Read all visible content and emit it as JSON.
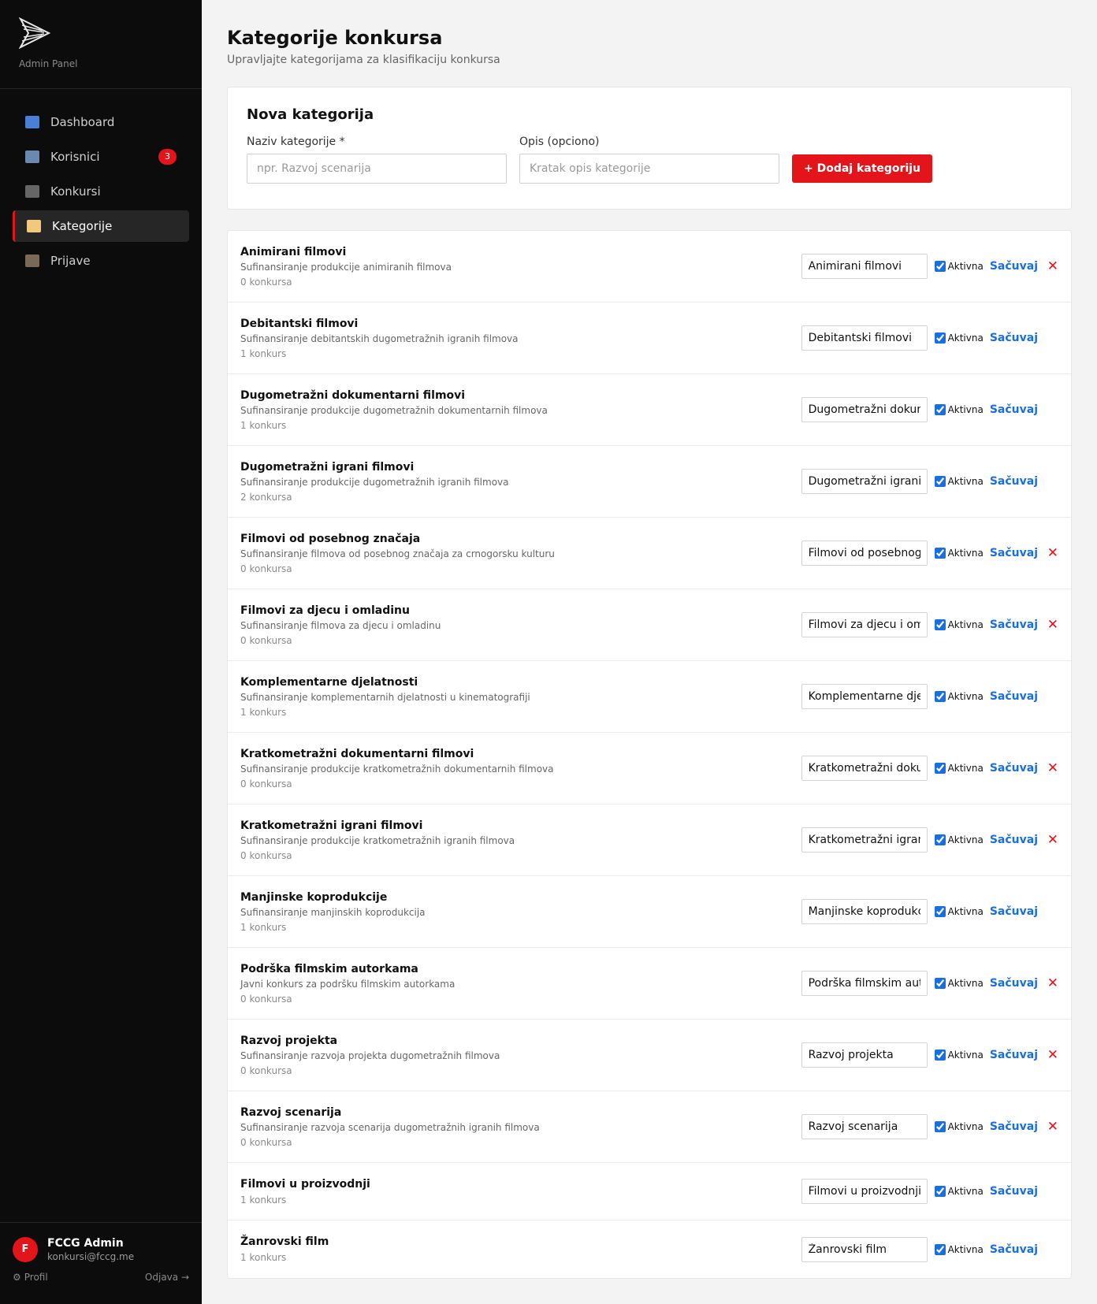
{
  "sidebar": {
    "logo_sub": "Admin Panel",
    "nav": [
      {
        "label": "Dashboard",
        "icon": "chart-icon",
        "color": "#4a7fd6"
      },
      {
        "label": "Korisnici",
        "icon": "users-icon",
        "color": "#6a89b0",
        "badge": "3"
      },
      {
        "label": "Konkursi",
        "icon": "clapper-icon",
        "color": "#666666"
      },
      {
        "label": "Kategorije",
        "icon": "tag-icon",
        "color": "#f2c97a",
        "active": true
      },
      {
        "label": "Prijave",
        "icon": "clipboard-icon",
        "color": "#7a6a55"
      }
    ],
    "user": {
      "initial": "F",
      "name": "FCCG Admin",
      "email": "konkursi@fccg.me",
      "profile_label": "Profil",
      "logout_label": "Odjava →"
    }
  },
  "header": {
    "title": "Kategorije konkursa",
    "subtitle": "Upravljajte kategorijama za klasifikaciju konkursa"
  },
  "new_category": {
    "heading": "Nova kategorija",
    "name_label": "Naziv kategorije *",
    "name_placeholder": "npr. Razvoj scenarija",
    "desc_label": "Opis (opciono)",
    "desc_placeholder": "Kratak opis kategorije",
    "add_label": "+ Dodaj kategoriju"
  },
  "labels": {
    "active": "Aktivna",
    "save": "Sačuvaj",
    "delete": "✕"
  },
  "categories": [
    {
      "title": "Animirani filmovi",
      "desc": "Sufinansiranje produkcije animiranih filmova",
      "count": "0 konkursa",
      "value": "Animirani filmovi",
      "active": true,
      "deletable": true
    },
    {
      "title": "Debitantski filmovi",
      "desc": "Sufinansiranje debitantskih dugometražnih igranih filmova",
      "count": "1 konkurs",
      "value": "Debitantski filmovi",
      "active": true,
      "deletable": false
    },
    {
      "title": "Dugometražni dokumentarni filmovi",
      "desc": "Sufinansiranje produkcije dugometražnih dokumentarnih filmova",
      "count": "1 konkurs",
      "value": "Dugometražni dokumentarni filmovi",
      "active": true,
      "deletable": false
    },
    {
      "title": "Dugometražni igrani filmovi",
      "desc": "Sufinansiranje produkcije dugometražnih igranih filmova",
      "count": "2 konkursa",
      "value": "Dugometražni igrani filmovi",
      "active": true,
      "deletable": false
    },
    {
      "title": "Filmovi od posebnog značaja",
      "desc": "Sufinansiranje filmova od posebnog značaja za crnogorsku kulturu",
      "count": "0 konkursa",
      "value": "Filmovi od posebnog značaja",
      "active": true,
      "deletable": true
    },
    {
      "title": "Filmovi za djecu i omladinu",
      "desc": "Sufinansiranje filmova za djecu i omladinu",
      "count": "0 konkursa",
      "value": "Filmovi za djecu i omladinu",
      "active": true,
      "deletable": true
    },
    {
      "title": "Komplementarne djelatnosti",
      "desc": "Sufinansiranje komplementarnih djelatnosti u kinematografiji",
      "count": "1 konkurs",
      "value": "Komplementarne djelatnosti",
      "active": true,
      "deletable": false
    },
    {
      "title": "Kratkometražni dokumentarni filmovi",
      "desc": "Sufinansiranje produkcije kratkometražnih dokumentarnih filmova",
      "count": "0 konkursa",
      "value": "Kratkometražni dokumentarni filmovi",
      "active": true,
      "deletable": true
    },
    {
      "title": "Kratkometražni igrani filmovi",
      "desc": "Sufinansiranje produkcije kratkometražnih igranih filmova",
      "count": "0 konkursa",
      "value": "Kratkometražni igrani filmovi",
      "active": true,
      "deletable": true
    },
    {
      "title": "Manjinske koprodukcije",
      "desc": "Sufinansiranje manjinskih koprodukcija",
      "count": "1 konkurs",
      "value": "Manjinske koprodukcije",
      "active": true,
      "deletable": false
    },
    {
      "title": "Podrška filmskim autorkama",
      "desc": "Javni konkurs za podršku filmskim autorkama",
      "count": "0 konkursa",
      "value": "Podrška filmskim autorkama",
      "active": true,
      "deletable": true
    },
    {
      "title": "Razvoj projekta",
      "desc": "Sufinansiranje razvoja projekta dugometražnih filmova",
      "count": "0 konkursa",
      "value": "Razvoj projekta",
      "active": true,
      "deletable": true
    },
    {
      "title": "Razvoj scenarija",
      "desc": "Sufinansiranje razvoja scenarija dugometražnih igranih filmova",
      "count": "0 konkursa",
      "value": "Razvoj scenarija",
      "active": true,
      "deletable": true
    },
    {
      "title": "Filmovi u proizvodnji",
      "desc": "",
      "count": "1 konkurs",
      "value": "Filmovi u proizvodnji",
      "active": true,
      "deletable": false
    },
    {
      "title": "Žanrovski film",
      "desc": "",
      "count": "1 konkurs",
      "value": "Žanrovski film",
      "active": true,
      "deletable": false
    }
  ]
}
